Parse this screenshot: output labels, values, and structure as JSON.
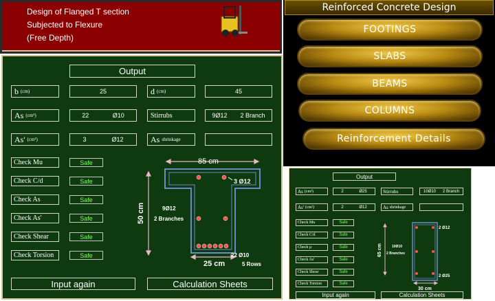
{
  "header": {
    "lines": [
      "Design of Flanged T section",
      "Subjected to Flexure",
      "(Free Depth)"
    ],
    "forklift_icon": "forklift-icon"
  },
  "menu": {
    "title": "Reinforced Concrete Design",
    "items": [
      "FOOTINGS",
      "SLABS",
      "BEAMS",
      "COLUMNS",
      "Reinforcement Details"
    ]
  },
  "main": {
    "output_title": "Output",
    "fields": {
      "b_label": "b",
      "b_unit": "(cm)",
      "b_value": "25",
      "d_label": "d",
      "d_unit": "(cm)",
      "d_value": "45",
      "as_label": "As",
      "as_unit": "(cm²)",
      "as_num": "22",
      "as_bar": "Ø10",
      "stirrups_label": "Stirrubs",
      "stirrups_value": "9Ø12",
      "stirrups_branch": "2 Branch",
      "as2_label": "As'",
      "as2_unit": "(cm²)",
      "as2_num": "3",
      "as2_bar": "Ø12",
      "ass_label": "As",
      "ass_unit": "shrinkage",
      "ass_value": ""
    },
    "checks": [
      {
        "label": "Check Mu",
        "status": "Safe"
      },
      {
        "label": "Check C/d",
        "status": "Safe"
      },
      {
        "label": "Check As",
        "status": "Safe"
      },
      {
        "label": "Check As'",
        "status": "Safe"
      },
      {
        "label": "Check Shear",
        "status": "Safe"
      },
      {
        "label": "Check Torsion",
        "status": "Safe"
      }
    ],
    "drawing": {
      "flange_width": "85  cm",
      "top_bars": "3  Ø12",
      "depth": "50  cm",
      "stirrup_line1": "9Ø12",
      "stirrup_line2": "2 Branches",
      "bottom_bars": "22  Ø10",
      "web_width": "25  cm",
      "rows": "5  Rows"
    },
    "buttons": {
      "input_again": "Input again",
      "calc_sheets": "Calculation Sheets"
    }
  },
  "small": {
    "output_title": "Output",
    "as_label": "As",
    "as_unit": "(cm²)",
    "as_num": "2",
    "as_bar": "Ø25",
    "stirrups_label": "Stirrubs",
    "stirrups_value": "10Ø10",
    "stirrups_branch": "2 Branch",
    "as2_label": "As'",
    "as2_unit": "(cm²)",
    "as2_num": "2",
    "as2_bar": "Ø12",
    "ass_label": "As",
    "ass_unit": "shrinkage",
    "checks": [
      {
        "label": "Check Mu",
        "status": "Safe"
      },
      {
        "label": "Check C/d",
        "status": "Safe"
      },
      {
        "label": "Check µ",
        "status": "Safe"
      },
      {
        "label": "Check As'",
        "status": "Safe"
      },
      {
        "label": "Check Shear",
        "status": "Safe"
      },
      {
        "label": "Check Torsion",
        "status": "Safe"
      }
    ],
    "drawing": {
      "top_bars": "2  Ø12",
      "depth": "65  cm",
      "stirrup_line1": "10Ø10",
      "stirrup_line2": "2 Branches",
      "bottom_bars": "2  Ø25",
      "width": "30  cm"
    },
    "buttons": {
      "input_again": "Input again",
      "calc_sheets": "Calculation Sheets"
    }
  },
  "colors": {
    "panel": "#0f3a0f",
    "safe": "#7cff5a",
    "title_red": "#8b0000",
    "gold": "#d4a017",
    "rebar": "#ff4040",
    "stirrup": "#6a8cc8"
  }
}
